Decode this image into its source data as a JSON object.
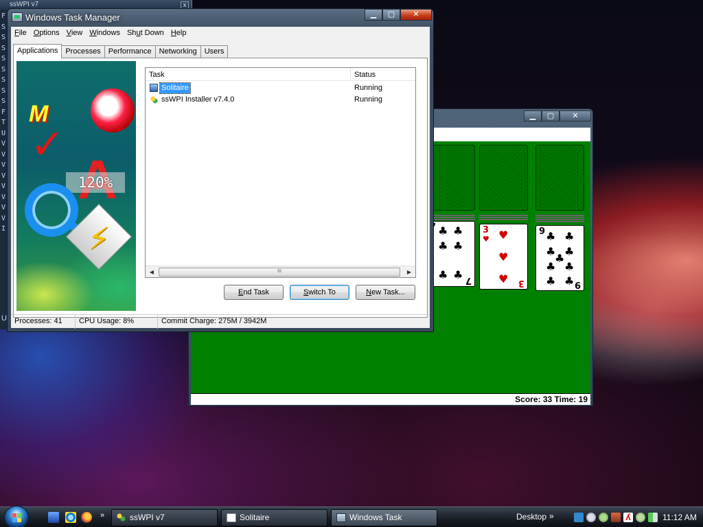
{
  "background_window": {
    "title": "ssWPI v7",
    "side_letters": "F\nS\nS\nS\nS\nS\nS\nS\nS\nF\nT\nU\nV\nV\nV\nV\nV\nV\nV\nV\nI",
    "bottom_fragment": "U"
  },
  "solitaire": {
    "score_text": "Score: 33 Time: 19",
    "cards": [
      {
        "rank": "7",
        "suit": "♣",
        "color": "black"
      },
      {
        "rank": "3",
        "suit": "♥",
        "color": "red"
      },
      {
        "rank": "9",
        "suit": "♣",
        "color": "black"
      }
    ]
  },
  "task_manager": {
    "title": "Windows Task Manager",
    "menu": [
      {
        "label": "File",
        "accel": "F",
        "rest": "ile"
      },
      {
        "label": "Options",
        "accel": "O",
        "rest": "ptions"
      },
      {
        "label": "View",
        "accel": "V",
        "rest": "iew"
      },
      {
        "label": "Windows",
        "accel": "W",
        "rest": "indows"
      },
      {
        "label": "Shut Down",
        "pre": "Sh",
        "accel": "u",
        "rest": "t Down"
      },
      {
        "label": "Help",
        "accel": "H",
        "rest": "elp"
      }
    ],
    "tabs": [
      "Applications",
      "Processes",
      "Performance",
      "Networking",
      "Users"
    ],
    "active_tab": "Applications",
    "banner_zoom": "120%",
    "columns": {
      "task": "Task",
      "status": "Status"
    },
    "tasks": [
      {
        "name": "Solitaire",
        "status": "Running",
        "selected": true,
        "icon": "solitaire-icon"
      },
      {
        "name": "ssWPI Installer v7.4.0",
        "status": "Running",
        "selected": false,
        "icon": "sswpi-icon"
      }
    ],
    "scroll_grip": "III",
    "buttons": {
      "end_task": {
        "accel": "E",
        "rest": "nd Task"
      },
      "switch_to": {
        "accel": "S",
        "rest": "witch To"
      },
      "new_task": {
        "accel": "N",
        "rest": "ew Task..."
      }
    },
    "status": {
      "processes": "Processes: 41",
      "cpu": "CPU Usage: 8%",
      "commit": "Commit Charge: 275M / 3942M"
    }
  },
  "taskbar": {
    "buttons": [
      {
        "label": "ssWPI v7",
        "active": false
      },
      {
        "label": "Solitaire",
        "active": false
      },
      {
        "label": "Windows Task Manager",
        "active": true
      }
    ],
    "chevron": "»",
    "desktop_label": "Desktop",
    "clock": "11:12 AM"
  },
  "colors": {
    "felt": "#008000",
    "selection": "#3399ff",
    "close_button": "#c8401c"
  }
}
